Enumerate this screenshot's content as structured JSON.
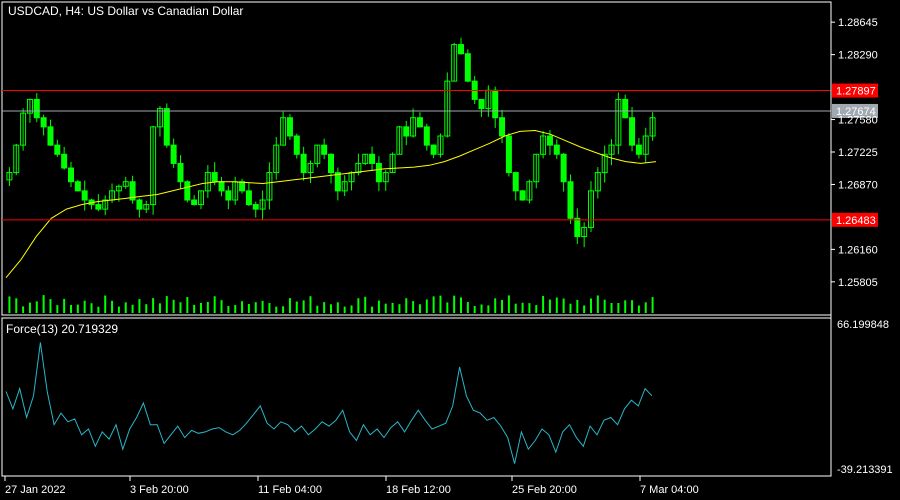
{
  "window": {
    "symbol_line": "USDCAD, H4:  US Dollar vs Canadian Dollar"
  },
  "indicator": {
    "label": "Force(13) 20.719329",
    "scale_top": "66.199848",
    "scale_bottom": "-39.213391"
  },
  "colors": {
    "background": "#000000",
    "candle": "#00ff00",
    "moving_average": "#ffff00",
    "level_line": "#ff0000",
    "current_price_line": "#a0a8b0",
    "force_line": "#29b6c8",
    "grid_frame": "#ffffff"
  },
  "chart_data": [
    {
      "type": "line",
      "title": "USDCAD, H4:  US Dollar vs Canadian Dollar",
      "y_ticks": [
        "1.28645",
        "1.28290",
        "1.27580",
        "1.27225",
        "1.26870",
        "1.26160",
        "1.25805"
      ],
      "x_ticks": [
        "27 Jan 2022",
        "3 Feb 20:00",
        "11 Feb 04:00",
        "18 Feb 12:00",
        "25 Feb 20:00",
        "7 Mar 04:00"
      ],
      "ylim": [
        1.2565,
        1.288
      ],
      "horizontal_levels": [
        {
          "label": "1.27897",
          "value": 1.27897,
          "color": "#ff0000"
        },
        {
          "label": "1.27674",
          "value": 1.27674,
          "color": "#a0a8b0"
        },
        {
          "label": "1.26483",
          "value": 1.26483,
          "color": "#ff0000"
        }
      ],
      "series": [
        {
          "name": "price",
          "values": [
            1.27,
            1.273,
            1.2765,
            1.278,
            1.276,
            1.275,
            1.273,
            1.272,
            1.2705,
            1.269,
            1.268,
            1.267,
            1.2665,
            1.266,
            1.267,
            1.268,
            1.2685,
            1.269,
            1.267,
            1.266,
            1.2665,
            1.275,
            1.277,
            1.273,
            1.271,
            1.269,
            1.267,
            1.2665,
            1.268,
            1.27,
            1.269,
            1.268,
            1.267,
            1.269,
            1.268,
            1.2665,
            1.266,
            1.267,
            1.27,
            1.273,
            1.276,
            1.274,
            1.272,
            1.27,
            1.271,
            1.273,
            1.272,
            1.27,
            1.268,
            1.269,
            1.27,
            1.271,
            1.272,
            1.271,
            1.269,
            1.27,
            1.272,
            1.275,
            1.274,
            1.276,
            1.275,
            1.273,
            1.272,
            1.274,
            1.28,
            1.284,
            1.283,
            1.28,
            1.278,
            1.277,
            1.279,
            1.276,
            1.274,
            1.27,
            1.268,
            1.267,
            1.269,
            1.272,
            1.274,
            1.273,
            1.272,
            1.269,
            1.265,
            1.263,
            1.264,
            1.268,
            1.27,
            1.272,
            1.273,
            1.278,
            1.276,
            1.273,
            1.272,
            1.274,
            1.276
          ]
        },
        {
          "name": "moving average",
          "values": [
            1.2585,
            1.2605,
            1.263,
            1.265,
            1.266,
            1.2665,
            1.2668,
            1.267,
            1.2672,
            1.2674,
            1.2676,
            1.268,
            1.2684,
            1.2688,
            1.269,
            1.269,
            1.2689,
            1.2688,
            1.269,
            1.2692,
            1.2694,
            1.2696,
            1.2698,
            1.27,
            1.2702,
            1.2704,
            1.2705,
            1.2706,
            1.2708,
            1.2712,
            1.2718,
            1.2725,
            1.2732,
            1.274,
            1.2745,
            1.2746,
            1.2742,
            1.2735,
            1.2728,
            1.2722,
            1.2716,
            1.2712,
            1.271,
            1.2712
          ]
        }
      ]
    },
    {
      "type": "line",
      "title": "Force(13) 20.719329",
      "ylim": [
        -39.213391,
        66.199848
      ],
      "series": [
        {
          "name": "Force(13)",
          "values": [
            18,
            6,
            20,
            0,
            15,
            52,
            18,
            -5,
            3,
            -3,
            -1,
            -12,
            -8,
            -20,
            -10,
            -15,
            -5,
            -22,
            -8,
            0,
            10,
            -5,
            -5,
            -18,
            -12,
            -6,
            -14,
            -9,
            -11,
            -10,
            -8,
            -7,
            -10,
            -12,
            -9,
            -4,
            2,
            8,
            -4,
            -8,
            -3,
            -5,
            -10,
            -6,
            -12,
            -8,
            -3,
            -6,
            -2,
            5,
            -10,
            -16,
            -5,
            -12,
            -8,
            -14,
            -7,
            -3,
            -10,
            -2,
            5,
            -2,
            -8,
            -6,
            -4,
            8,
            35,
            15,
            5,
            3,
            -2,
            0,
            -6,
            -14,
            -32,
            -10,
            -22,
            -16,
            -8,
            -12,
            -24,
            -10,
            -5,
            -14,
            -20,
            -6,
            -12,
            -2,
            0,
            -5,
            6,
            12,
            8,
            20,
            15
          ]
        }
      ]
    }
  ]
}
